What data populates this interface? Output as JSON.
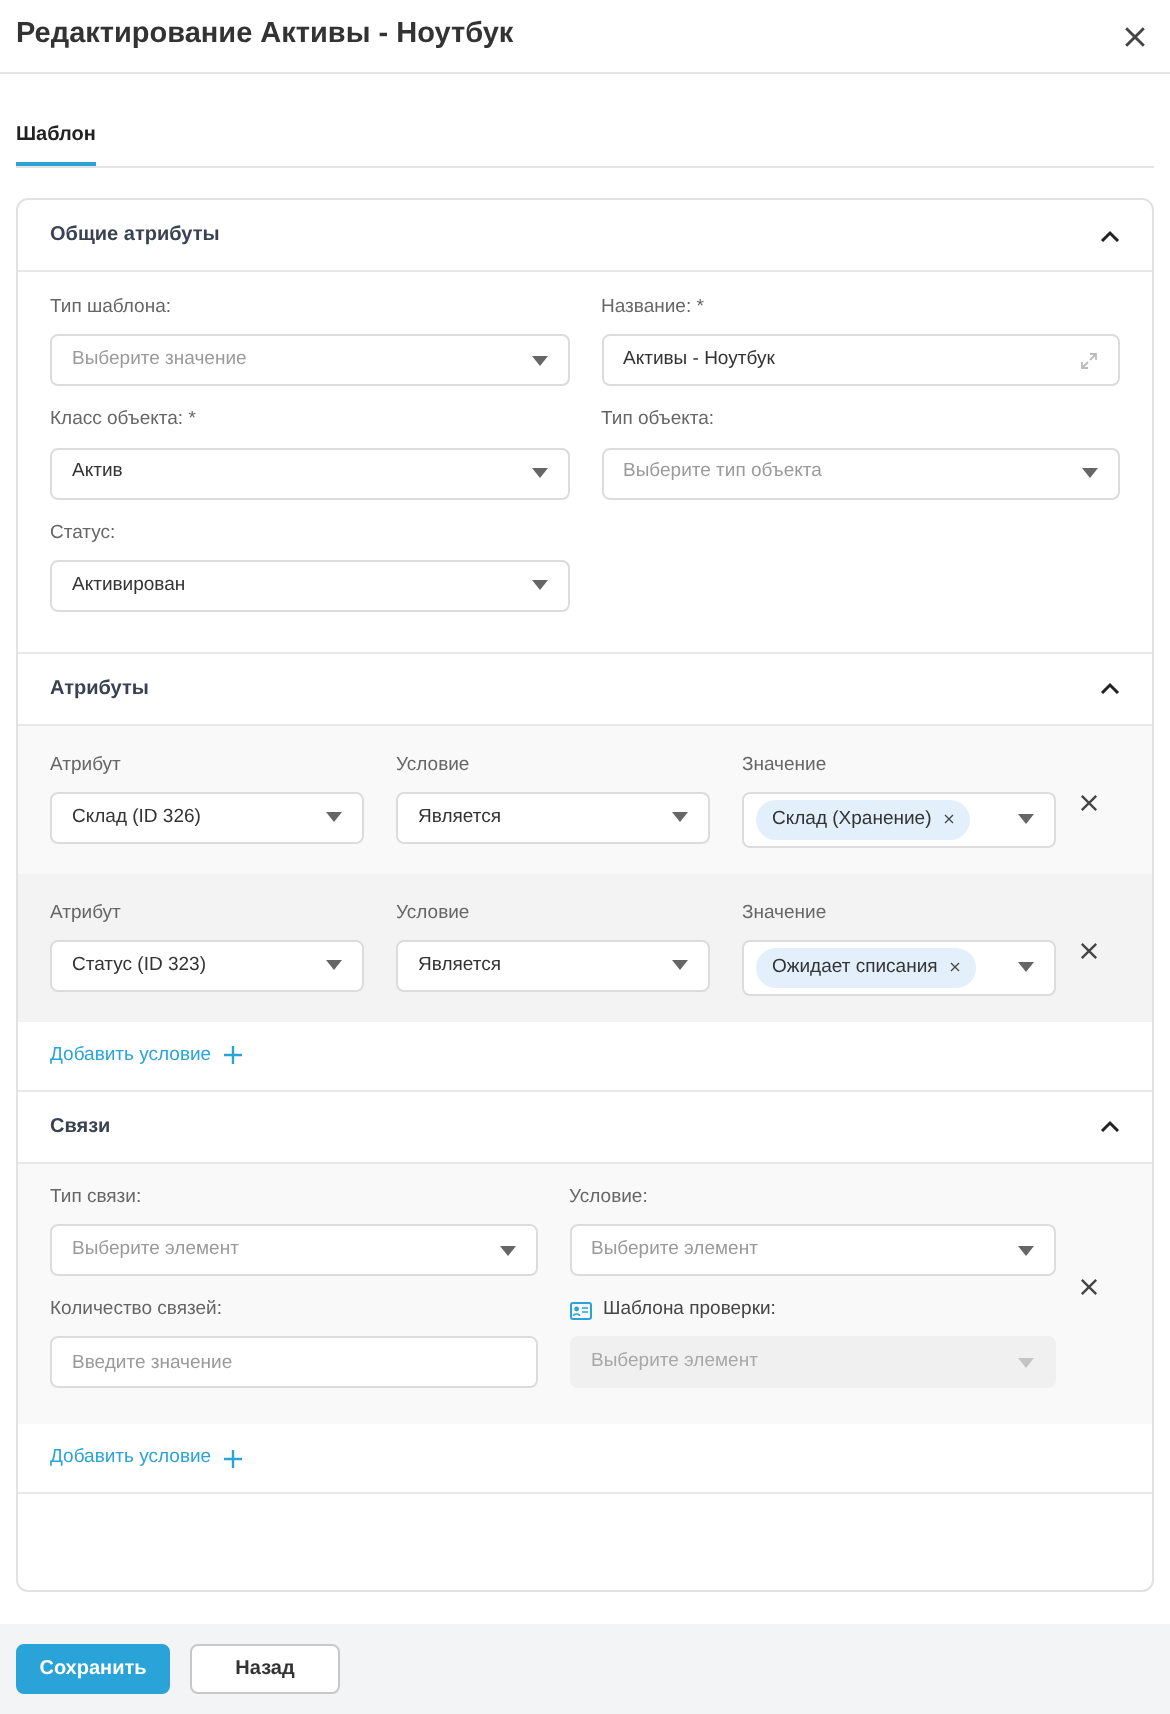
{
  "title": "Редактирование Активы - Ноутбук",
  "tabs": [
    {
      "label": "Шаблон",
      "selected": true
    }
  ],
  "general": {
    "title": "Общие атрибуты",
    "expanded": true,
    "fields": [
      {
        "label": "Тип шаблона:",
        "kind": "select",
        "placeholder": "Выберите значение"
      },
      {
        "label": "Название: *",
        "kind": "text",
        "value": "Активы - Ноутбук"
      },
      {
        "label": "Класс объекта: *",
        "kind": "select",
        "value": "Актив"
      },
      {
        "label": "Тип объекта:",
        "kind": "select",
        "placeholder": "Выберите тип объекта"
      },
      {
        "label": "Статус:",
        "kind": "select",
        "value": "Активирован"
      }
    ]
  },
  "attributes": {
    "title": "Атрибуты",
    "expanded": true,
    "rows": [
      {
        "highlighted": false,
        "fields": [
          {
            "label": "Атрибут",
            "kind": "select",
            "value": "Склад (ID 326)"
          },
          {
            "label": "Условие",
            "kind": "select",
            "value": "Является"
          },
          {
            "label": "Значение",
            "kind": "tags",
            "tags": [
              "Склад (Хранение)"
            ]
          }
        ]
      },
      {
        "highlighted": true,
        "fields": [
          {
            "label": "Атрибут",
            "kind": "select",
            "value": "Статус (ID 323)"
          },
          {
            "label": "Условие",
            "kind": "select",
            "value": "Является"
          },
          {
            "label": "Значение",
            "kind": "tags",
            "tags": [
              "Ожидает списания"
            ]
          }
        ]
      }
    ],
    "add_label": "Добавить условие"
  },
  "links": {
    "title": "Связи",
    "expanded": true,
    "rows": [
      {
        "highlighted": false,
        "fields": [
          {
            "label": "Тип связи:",
            "kind": "select",
            "placeholder": "Выберите элемент"
          },
          {
            "label": "Условие:",
            "kind": "select",
            "placeholder": "Выберите элемент"
          },
          {
            "label": "Количество связей:",
            "kind": "input",
            "placeholder": "Введите значение"
          },
          {
            "label": "Шаблона проверки:",
            "kind": "select",
            "placeholder": "Выберите элемент",
            "disabled": true,
            "label_icon": true
          }
        ]
      }
    ],
    "add_label": "Добавить условие"
  },
  "buttons": [
    {
      "label": "Сохранить",
      "kind": "primary"
    },
    {
      "label": "Назад",
      "kind": "secondary"
    }
  ]
}
